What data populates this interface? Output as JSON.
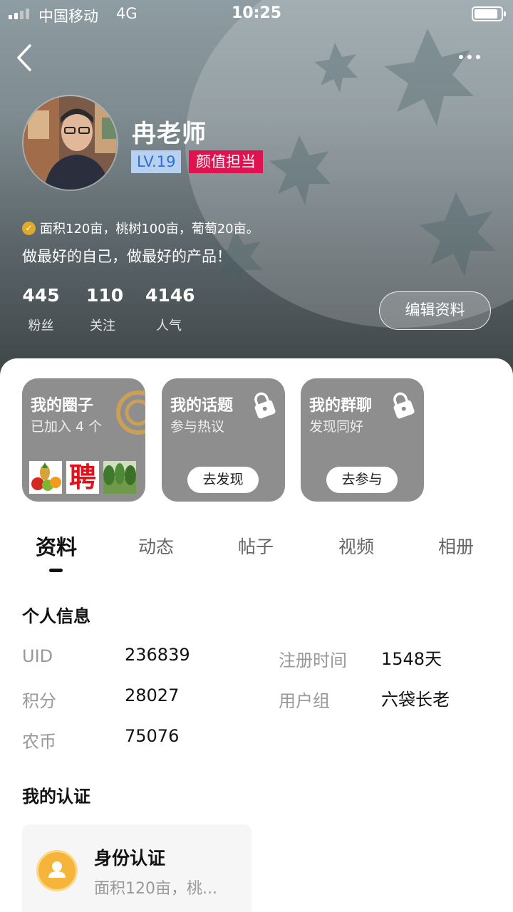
{
  "status_bar": {
    "carrier": "中国移动",
    "network": "4G",
    "time": "10:25"
  },
  "profile": {
    "name": "冉老师",
    "level": "LV.19",
    "title_badge": "颜值担当",
    "farm_info": "面积120亩，桃树100亩，葡萄20亩。",
    "bio": "做最好的自己，做最好的产品！",
    "edit_label": "编辑资料",
    "stats": [
      {
        "value": "445",
        "label": "粉丝"
      },
      {
        "value": "110",
        "label": "关注"
      },
      {
        "value": "4146",
        "label": "人气"
      }
    ]
  },
  "cards": [
    {
      "title": "我的圈子",
      "subtitle": "已加入 4 个",
      "thumb_text": "聘"
    },
    {
      "title": "我的话题",
      "subtitle": "参与热议",
      "action": "去发现"
    },
    {
      "title": "我的群聊",
      "subtitle": "发现同好",
      "action": "去参与"
    }
  ],
  "tabs": [
    "资料",
    "动态",
    "帖子",
    "视频",
    "相册"
  ],
  "personal_info": {
    "title": "个人信息",
    "uid_label": "UID",
    "uid": "236839",
    "reg_label": "注册时间",
    "reg": "1548天",
    "points_label": "积分",
    "points": "28027",
    "group_label": "用户组",
    "group": "六袋长老",
    "coins_label": "农币",
    "coins": "75076"
  },
  "certification": {
    "title": "我的认证",
    "card_title": "身份认证",
    "card_desc": "面积120亩，桃..."
  },
  "colors": {
    "badge_pink": "#e0124f",
    "level_blue": "#b9d1f0",
    "cert_orange": "#f5b43a"
  }
}
